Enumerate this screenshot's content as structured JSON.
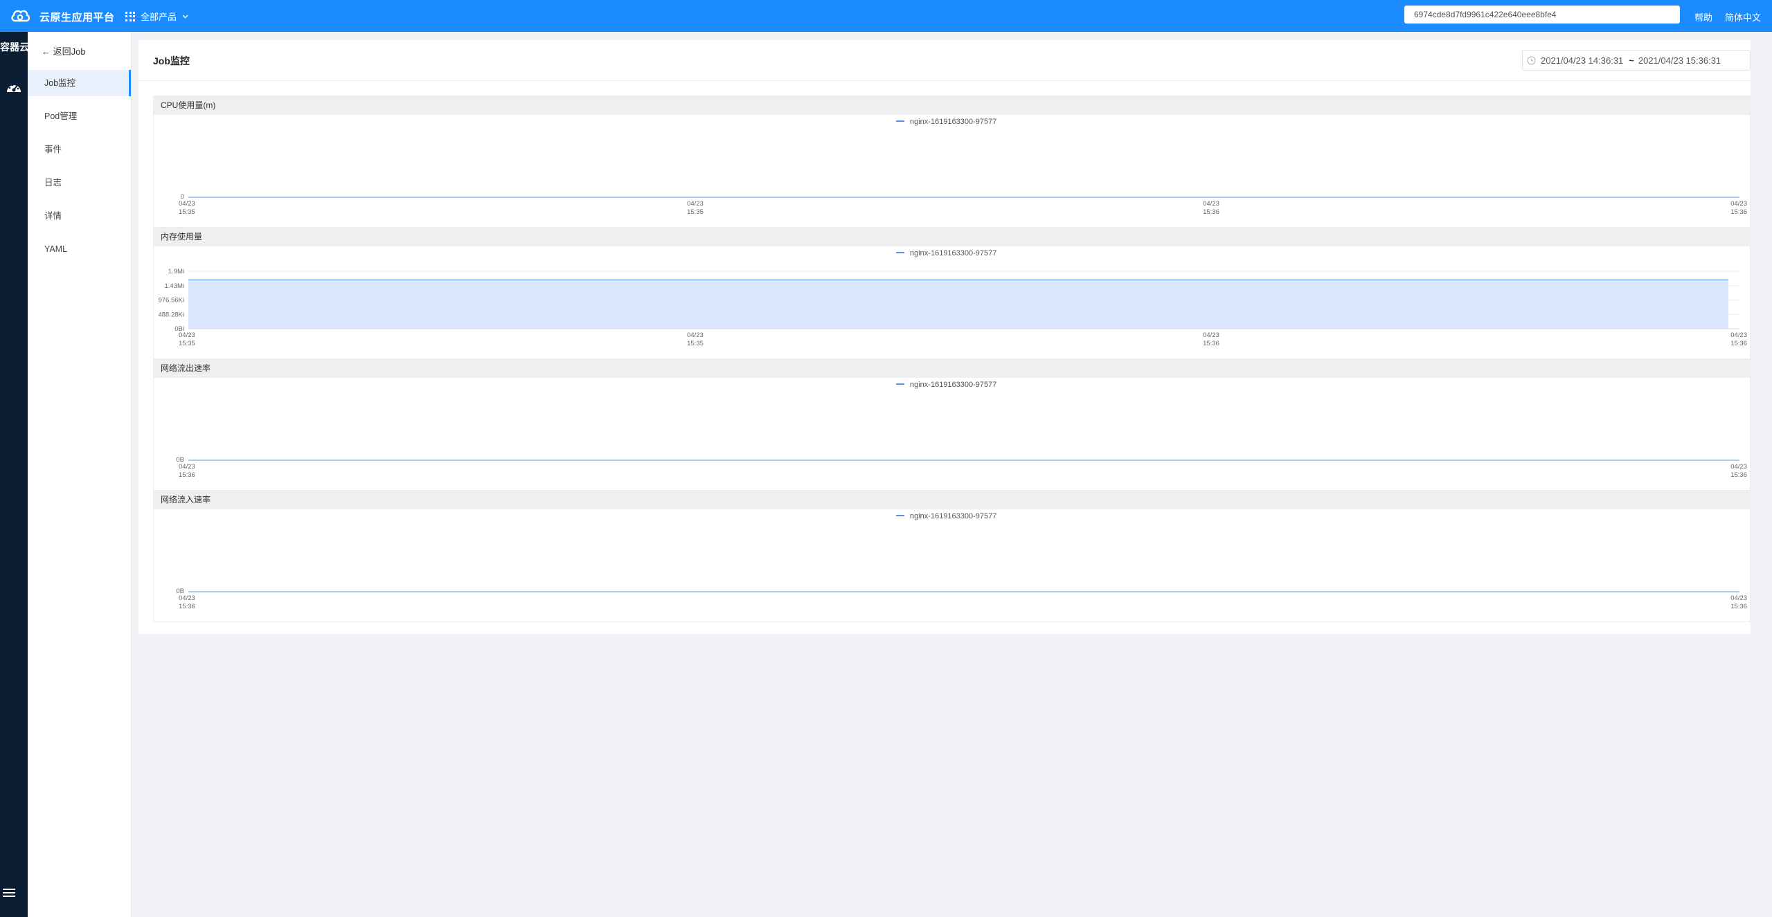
{
  "topbar": {
    "brand": "云原生应用平台",
    "all_products": "全部产品",
    "search_value": "6974cde8d7fd9961c422e640eee8bfe4",
    "help": "帮助",
    "language": "简体中文"
  },
  "rail": {
    "title": "容器云"
  },
  "sidebar": {
    "back": "← 返回Job",
    "items": [
      {
        "label": "Job监控",
        "active": true
      },
      {
        "label": "Pod管理"
      },
      {
        "label": "事件"
      },
      {
        "label": "日志"
      },
      {
        "label": "详情"
      },
      {
        "label": "YAML"
      }
    ]
  },
  "page": {
    "title": "Job监控",
    "range_start": "2021/04/23 14:36:31",
    "range_sep": "~",
    "range_end": "2021/04/23 15:36:31"
  },
  "colors": {
    "accent": "#1a8cff",
    "line": "#5b8ff9",
    "area": "#d6e4fd",
    "rail": "#0b1e33"
  },
  "chart_data": [
    {
      "type": "line",
      "title": "CPU使用量(m)",
      "series": [
        {
          "name": "nginx-1619163300-97577",
          "values": [
            0,
            0
          ]
        }
      ],
      "x": [
        "04/23 15:35",
        "04/23 15:36"
      ],
      "xticks": [
        [
          "04/23",
          "15:35"
        ],
        [
          "04/23",
          "15:35"
        ],
        [
          "04/23",
          "15:36"
        ],
        [
          "04/23",
          "15:36"
        ]
      ],
      "yticks": [
        "0"
      ],
      "legend": "top-center",
      "grid": false
    },
    {
      "type": "area",
      "title": "内存使用量",
      "series": [
        {
          "name": "nginx-1619163300-97577",
          "values": [
            1.7,
            1.7
          ]
        }
      ],
      "unit": "Mi",
      "ylim": [
        0,
        2
      ],
      "xticks": [
        [
          "04/23",
          "15:35"
        ],
        [
          "04/23",
          "15:35"
        ],
        [
          "04/23",
          "15:36"
        ],
        [
          "04/23",
          "15:36"
        ]
      ],
      "yticks": [
        "0Bi",
        "488.28Ki",
        "976.56Ki",
        "1.43Mi",
        "1.9Mi"
      ],
      "legend": "top-center",
      "grid": true
    },
    {
      "type": "line",
      "title": "网络流出速率",
      "series": [
        {
          "name": "nginx-1619163300-97577",
          "values": [
            0,
            0
          ]
        }
      ],
      "xticks": [
        [
          "04/23",
          "15:36"
        ],
        [
          "04/23",
          "15:36"
        ]
      ],
      "yticks": [
        "0B"
      ],
      "legend": "top-center",
      "grid": false
    },
    {
      "type": "line",
      "title": "网络流入速率",
      "series": [
        {
          "name": "nginx-1619163300-97577",
          "values": [
            0,
            0
          ]
        }
      ],
      "xticks": [
        [
          "04/23",
          "15:36"
        ],
        [
          "04/23",
          "15:36"
        ]
      ],
      "yticks": [
        "0B"
      ],
      "legend": "top-center",
      "grid": false
    }
  ]
}
